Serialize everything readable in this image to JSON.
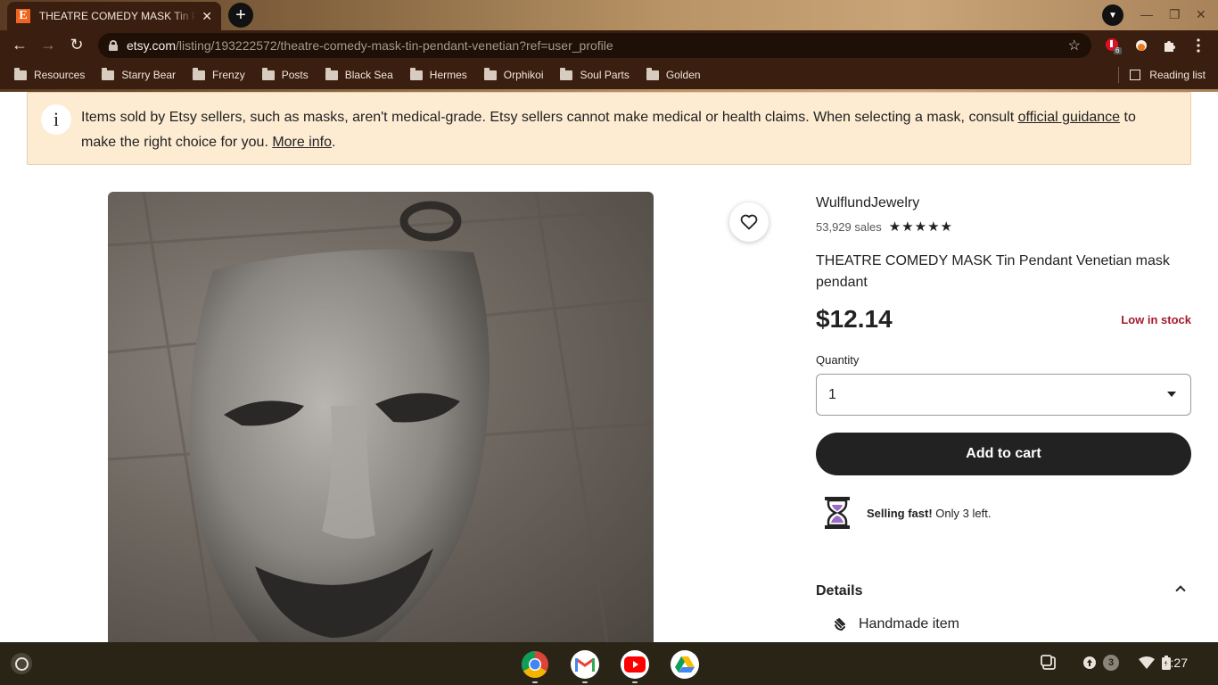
{
  "browser": {
    "tab_title": "THEATRE COMEDY MASK Tin Pendant Venetian mask pendant",
    "favicon_letter": "E",
    "url_host": "etsy.com",
    "url_path": "/listing/193222572/theatre-comedy-mask-tin-pendant-venetian?ref=user_profile",
    "extension_badge": "6",
    "bookmarks": [
      "Resources",
      "Starry Bear",
      "Frenzy",
      "Posts",
      "Black Sea",
      "Hermes",
      "Orphikoi",
      "Soul Parts",
      "Golden"
    ],
    "reading_list": "Reading list"
  },
  "notice": {
    "icon": "i",
    "text_before": "Items sold by Etsy sellers, such as masks, aren't medical-grade. Etsy sellers cannot make medical or health claims. When selecting a mask, consult ",
    "link_guidance": "official guidance",
    "text_middle": " to make the right choice for you. ",
    "link_more": "More info",
    "text_after": "."
  },
  "product": {
    "shop_name": "WulflundJewelry",
    "sales": "53,929 sales",
    "rating_stars": "★★★★★",
    "title": "THEATRE COMEDY MASK Tin Pendant Venetian mask pendant",
    "price": "$12.14",
    "stock": "Low in stock",
    "quantity_label": "Quantity",
    "quantity_value": "1",
    "add_to_cart": "Add to cart",
    "selling_fast": "Selling fast!",
    "selling_detail": " Only 3 left.",
    "details_heading": "Details",
    "detail_item": "Handmade item"
  },
  "shelf": {
    "notification_count": "3",
    "time": "1:27"
  },
  "colors": {
    "etsy_orange": "#f1641e",
    "low_stock_red": "#a61a2e",
    "notice_bg": "#fdebd2",
    "cart_button": "#222222"
  }
}
